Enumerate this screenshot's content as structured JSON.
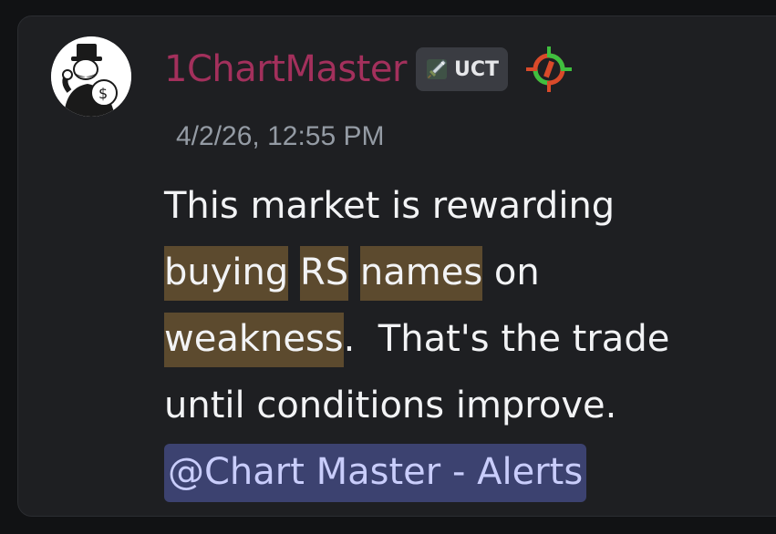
{
  "message": {
    "author": {
      "name": "1ChartMaster",
      "name_color": "#a3305c",
      "avatar_icon": "monopoly-man-avatar-icon",
      "role_tag": {
        "icon": "sword-icon",
        "label": "UCT"
      },
      "server_icon": "target-crosshair-icon"
    },
    "timestamp": "4/2/26, 12:55 PM",
    "content": {
      "line1": "This market is rewarding",
      "line2": {
        "w1": "buying",
        "w2": "RS",
        "w3": "names",
        "rest": " on"
      },
      "line3": {
        "w1": "weakness",
        "rest": ".  That's the trade"
      },
      "line4": "until conditions improve.",
      "mention": "@Chart Master - Alerts"
    },
    "colors": {
      "highlight": "#5c4a2e",
      "mention_bg": "#3c4270",
      "mention_text": "#c9cdfb"
    }
  }
}
